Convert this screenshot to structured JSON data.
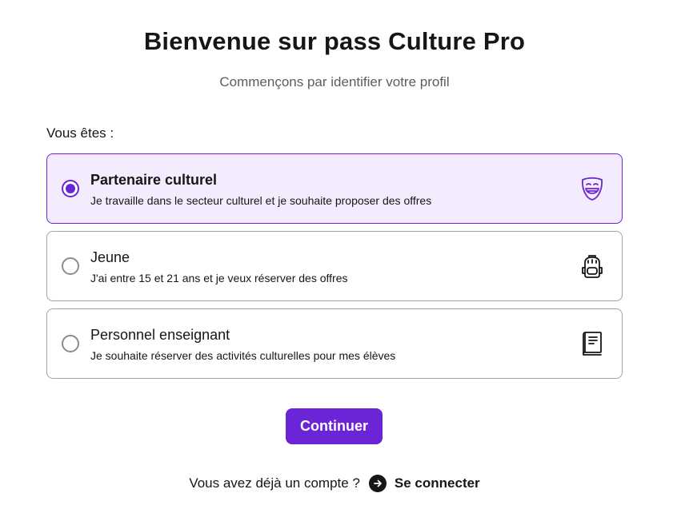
{
  "header": {
    "title": "Bienvenue sur pass Culture Pro",
    "subtitle": "Commençons par identifier votre profil"
  },
  "form": {
    "question": "Vous êtes :",
    "options": [
      {
        "title": "Partenaire culturel",
        "description": "Je travaille dans le secteur culturel et je souhaite proposer des offres",
        "icon": "theater-mask-icon",
        "selected": true
      },
      {
        "title": "Jeune",
        "description": "J'ai entre 15 et 21 ans et je veux réserver des offres",
        "icon": "backpack-icon",
        "selected": false
      },
      {
        "title": "Personnel enseignant",
        "description": "Je souhaite réserver des activités culturelles pour mes élèves",
        "icon": "book-icon",
        "selected": false
      }
    ],
    "continue_label": "Continuer"
  },
  "footer": {
    "prompt": "Vous avez déjà un compte ?",
    "login_label": "Se connecter"
  },
  "colors": {
    "accent": "#6b24d6",
    "selected_background": "#f3ebfe",
    "text": "#161617",
    "muted_text": "#5c5c63",
    "border": "#a0a0a8"
  }
}
